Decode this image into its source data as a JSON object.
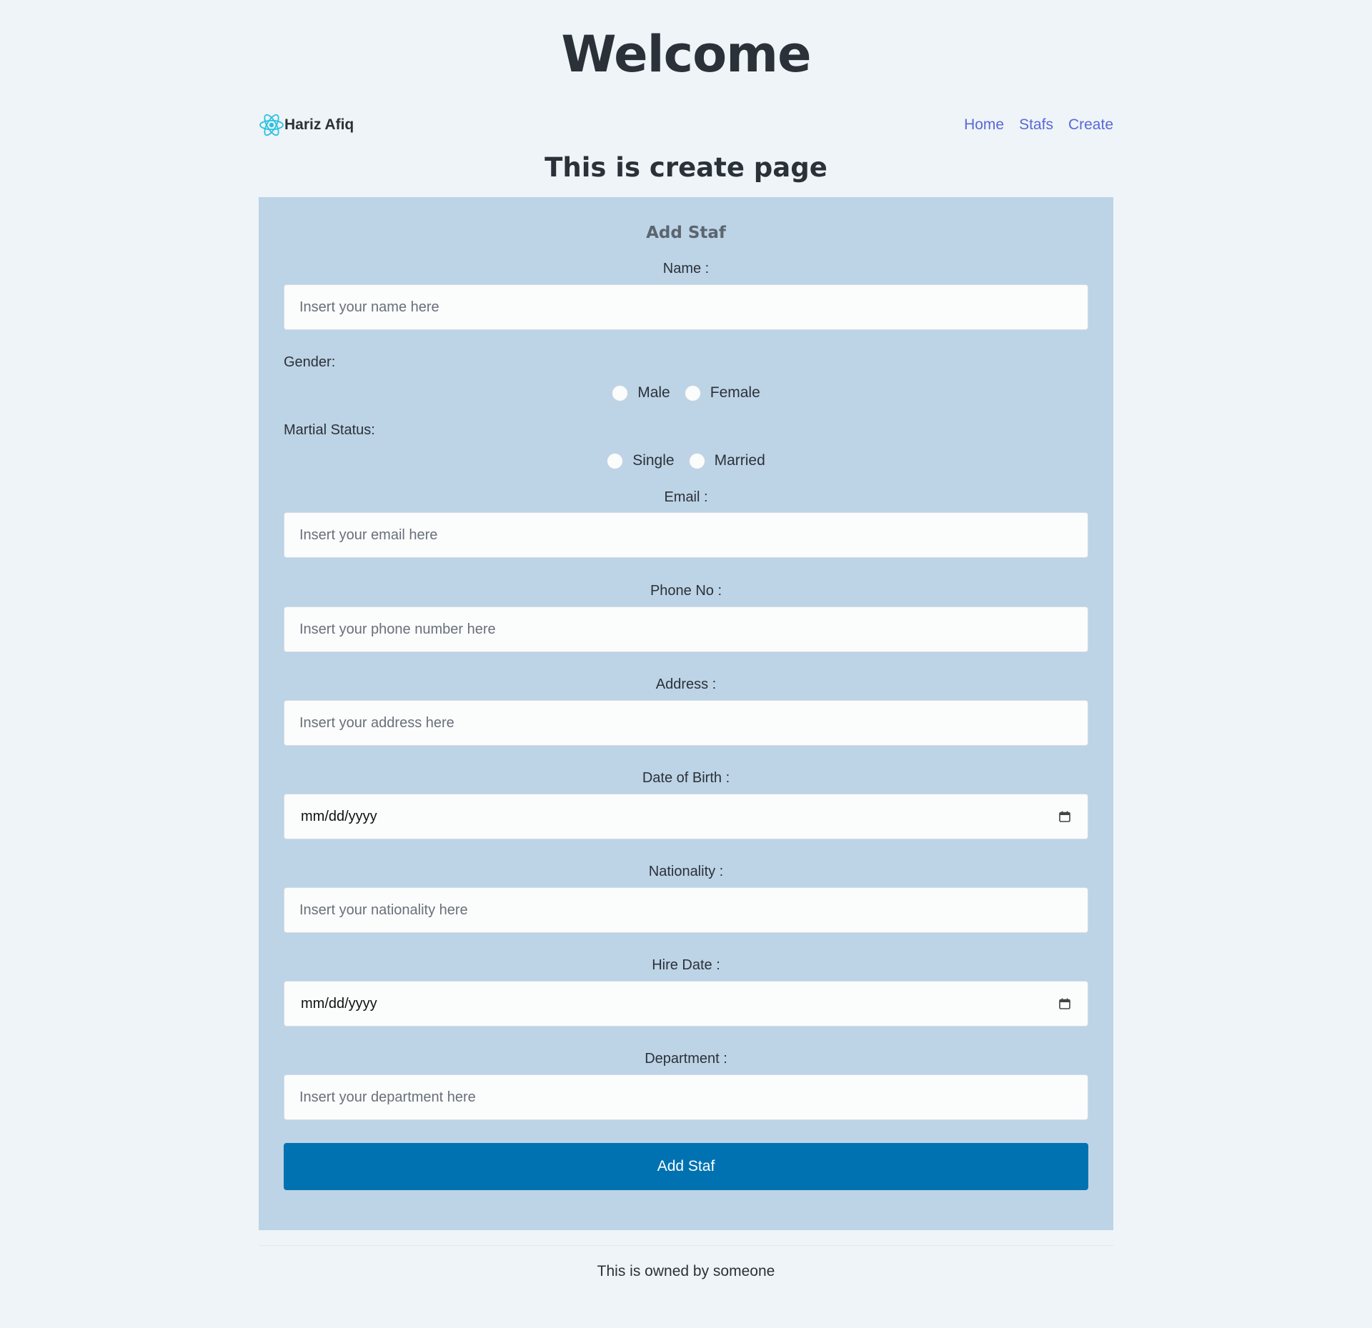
{
  "header": {
    "title": "Welcome"
  },
  "navbar": {
    "brand_name": "Hariz Afiq",
    "links": [
      {
        "label": "Home"
      },
      {
        "label": "Stafs"
      },
      {
        "label": "Create"
      }
    ],
    "link_color": "#5a67d8",
    "logo_color": "#2bc0e4"
  },
  "page": {
    "heading": "This is create page"
  },
  "form": {
    "title": "Add Staf",
    "name": {
      "label": "Name :",
      "placeholder": "Insert your name here",
      "value": ""
    },
    "gender": {
      "label": "Gender:",
      "options": [
        "Male",
        "Female"
      ]
    },
    "marital": {
      "label": "Martial Status:",
      "options": [
        "Single",
        "Married"
      ]
    },
    "email": {
      "label": "Email :",
      "placeholder": "Insert your email here",
      "value": ""
    },
    "phone": {
      "label": "Phone No :",
      "placeholder": "Insert your phone number here",
      "value": ""
    },
    "address": {
      "label": "Address :",
      "placeholder": "Insert your address here",
      "value": ""
    },
    "dob": {
      "label": "Date of Birth :",
      "value": "mm/dd/yyyy"
    },
    "nationality": {
      "label": "Nationality :",
      "placeholder": "Insert your nationality here",
      "value": ""
    },
    "hire_date": {
      "label": "Hire Date :",
      "value": "mm/dd/yyyy"
    },
    "department": {
      "label": "Department :",
      "placeholder": "Insert your department here",
      "value": ""
    },
    "submit_label": "Add Staf",
    "card_color": "#bdd3e6",
    "button_color": "#0072b1"
  },
  "footer": {
    "text": "This is owned by someone"
  }
}
